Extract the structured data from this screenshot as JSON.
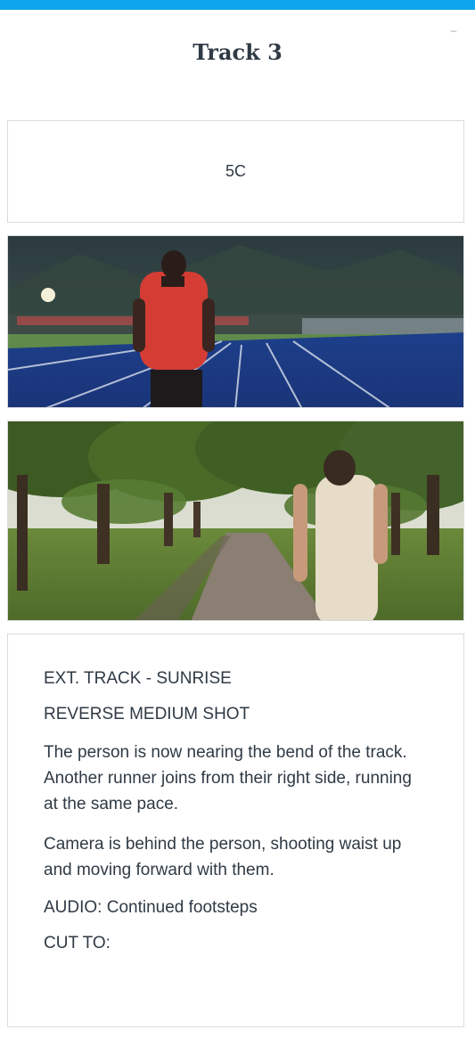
{
  "header": {
    "title": "Track 3",
    "minimize_symbol": "–"
  },
  "shot": {
    "code": "5C"
  },
  "images": [
    {
      "icon": "runner-track-photo"
    },
    {
      "icon": "runner-tree-lane-photo"
    }
  ],
  "script": {
    "lines": [
      "EXT. TRACK - SUNRISE",
      "REVERSE MEDIUM SHOT",
      "The person is now nearing the bend of the track. Another runner joins from their right side, running at the same pace.",
      "Camera is behind the person, shooting waist up and moving forward with them.",
      "AUDIO: Continued footsteps",
      "CUT TO:"
    ]
  },
  "colors": {
    "accent": "#0ea5ec",
    "text": "#2f3a45",
    "border": "#dcdcdc"
  }
}
